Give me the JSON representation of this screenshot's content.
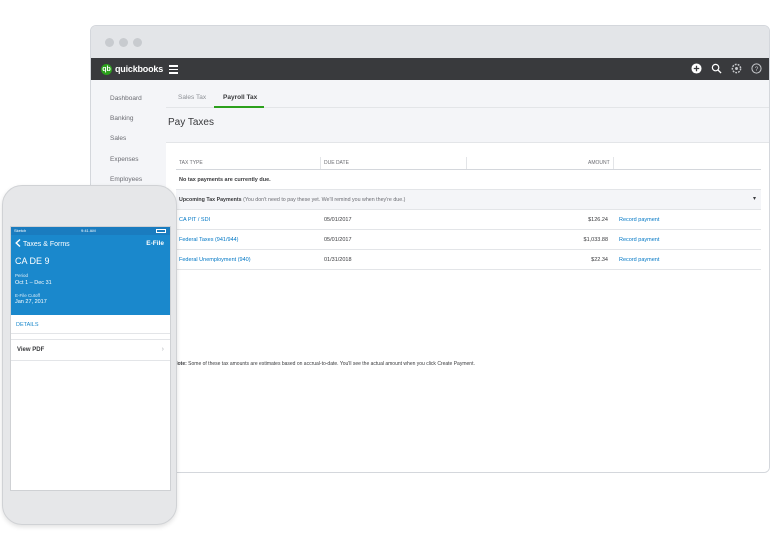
{
  "app": {
    "logo_text": "quickbooks",
    "logo_mark": "qb"
  },
  "topbar": {
    "icons": [
      "plus-icon",
      "search-icon",
      "gear-icon",
      "help-icon"
    ]
  },
  "sidebar": {
    "items": [
      {
        "label": "Dashboard"
      },
      {
        "label": "Banking"
      },
      {
        "label": "Sales"
      },
      {
        "label": "Expenses"
      },
      {
        "label": "Employees"
      }
    ]
  },
  "tabs": [
    {
      "label": "Sales Tax",
      "active": false
    },
    {
      "label": "Payroll Tax",
      "active": true
    }
  ],
  "page": {
    "title": "Pay Taxes"
  },
  "table": {
    "headers": {
      "tax_type": "TAX TYPE",
      "due_date": "DUE DATE",
      "amount": "AMOUNT"
    },
    "no_due_text": "No tax payments are currently due.",
    "upcoming": {
      "title": "Upcoming Tax Payments",
      "subtitle": "(You don't need to pay these yet. We'll remind you when they're due.)"
    },
    "rows": [
      {
        "tax_type": "CA PIT / SDI",
        "due_date": "05/01/2017",
        "amount": "$126.24",
        "action": "Record payment"
      },
      {
        "tax_type": "Federal Taxes (941/944)",
        "due_date": "05/01/2017",
        "amount": "$1,033.88",
        "action": "Record payment"
      },
      {
        "tax_type": "Federal Unemployment (940)",
        "due_date": "01/31/2018",
        "amount": "$22.34",
        "action": "Record payment"
      }
    ],
    "note_label": "Note:",
    "note_text": "Some of these tax amounts are estimates based on accrual-to-date. You'll see the actual amount when you click Create Payment."
  },
  "phone": {
    "status": {
      "carrier": "Sketch",
      "time": "9:41 AM"
    },
    "back_label": "Taxes & Forms",
    "efile_label": "E-File",
    "title": "CA DE 9",
    "period_label": "Period",
    "period_value": "Oct 1 – Dec 31",
    "cutoff_label": "E-File Cutoff",
    "cutoff_value": "Jan 27, 2017",
    "details_label": "DETAILS",
    "view_pdf_label": "View PDF"
  },
  "colors": {
    "brand_green": "#2ca01c",
    "topbar_dark": "#393a3d",
    "link_blue": "#0077c5",
    "phone_header_blue": "#1a88cc"
  }
}
